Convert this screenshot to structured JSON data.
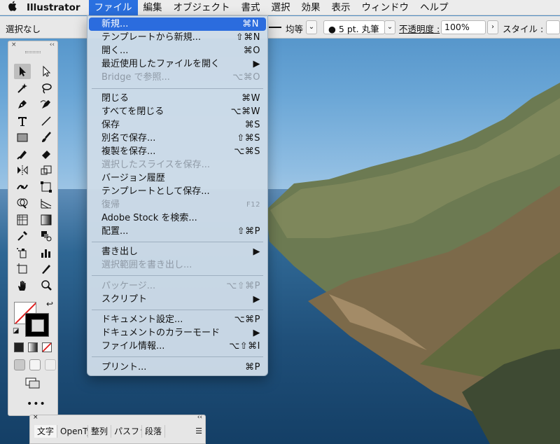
{
  "menubar": {
    "app_name": "Illustrator",
    "menus": [
      "ファイル",
      "編集",
      "オブジェクト",
      "書式",
      "選択",
      "効果",
      "表示",
      "ウィンドウ",
      "ヘルプ"
    ]
  },
  "controlbar": {
    "selection": "選択なし",
    "stroke_profile": "均等",
    "brush": "5 pt. 丸筆",
    "opacity_label": "不透明度 :",
    "opacity_value": "100%",
    "style_label": "スタイル :"
  },
  "tool_panel": {
    "close": "×",
    "collapse": "‹‹",
    "more": "•••"
  },
  "type_panel": {
    "close": "×",
    "collapse": "‹‹",
    "tabs": [
      "文字",
      "OpenTy",
      "整列",
      "パスファ",
      "段落"
    ]
  },
  "file_menu": {
    "items": [
      {
        "label": "新規...",
        "shortcut": "⌘N",
        "disabled": false,
        "highlight": true
      },
      {
        "label": "テンプレートから新規...",
        "shortcut": "⇧⌘N",
        "disabled": false
      },
      {
        "label": "開く...",
        "shortcut": "⌘O",
        "disabled": false
      },
      {
        "label": "最近使用したファイルを開く",
        "shortcut": "▶",
        "disabled": false
      },
      {
        "label": "Bridge で参照...",
        "shortcut": "⌥⌘O",
        "disabled": true
      },
      {
        "label": "閉じる",
        "shortcut": "⌘W",
        "disabled": false
      },
      {
        "label": "すべてを閉じる",
        "shortcut": "⌥⌘W",
        "disabled": false
      },
      {
        "label": "保存",
        "shortcut": "⌘S",
        "disabled": false
      },
      {
        "label": "別名で保存...",
        "shortcut": "⇧⌘S",
        "disabled": false
      },
      {
        "label": "複製を保存...",
        "shortcut": "⌥⌘S",
        "disabled": false
      },
      {
        "label": "選択したスライスを保存...",
        "shortcut": "",
        "disabled": true
      },
      {
        "label": "バージョン履歴",
        "shortcut": "",
        "disabled": false
      },
      {
        "label": "テンプレートとして保存...",
        "shortcut": "",
        "disabled": false
      },
      {
        "label": "復帰",
        "shortcut": "F12",
        "disabled": true
      },
      {
        "label": "Adobe Stock を検索...",
        "shortcut": "",
        "disabled": false
      },
      {
        "label": "配置...",
        "shortcut": "⇧⌘P",
        "disabled": false
      },
      {
        "label": "書き出し",
        "shortcut": "▶",
        "disabled": false
      },
      {
        "label": "選択範囲を書き出し...",
        "shortcut": "",
        "disabled": true
      },
      {
        "label": "パッケージ...",
        "shortcut": "⌥⇧⌘P",
        "disabled": true
      },
      {
        "label": "スクリプト",
        "shortcut": "▶",
        "disabled": false
      },
      {
        "label": "ドキュメント設定...",
        "shortcut": "⌥⌘P",
        "disabled": false
      },
      {
        "label": "ドキュメントのカラーモード",
        "shortcut": "▶",
        "disabled": false
      },
      {
        "label": "ファイル情報...",
        "shortcut": "⌥⇧⌘I",
        "disabled": false
      },
      {
        "label": "プリント...",
        "shortcut": "⌘P",
        "disabled": false
      }
    ]
  }
}
